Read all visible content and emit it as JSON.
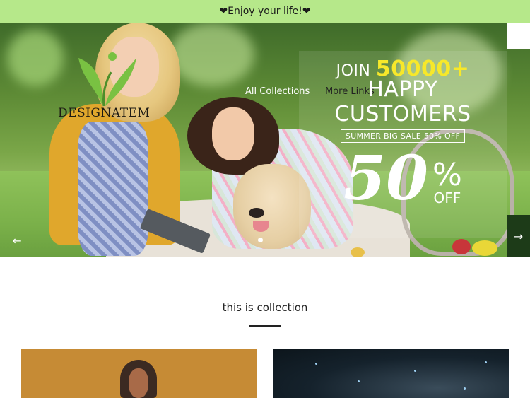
{
  "announcement": {
    "text": "❤Enjoy your life!❤"
  },
  "brand": {
    "name": "DESIGNATEM",
    "logo_icon": "leaf-logo-icon"
  },
  "nav": {
    "items": [
      {
        "label": "All Collections"
      },
      {
        "label": "More Links"
      }
    ]
  },
  "hero": {
    "promo": {
      "join_text": "JOIN",
      "join_number": "50000+",
      "happy_text": "HAPPY CUSTOMERS",
      "sale_text": "SUMMER BIG SALE 50% OFF",
      "big_number": "50",
      "percent": "%",
      "off": "OFF"
    },
    "prev_icon": "arrow-left-icon",
    "next_icon": "arrow-right-icon",
    "active_slide": 1
  },
  "collection": {
    "title": "this is collection"
  },
  "colors": {
    "announcement_bg": "#b6e88a",
    "accent_yellow": "#f7e82a",
    "next_arrow_bg": "#1d3b18"
  }
}
